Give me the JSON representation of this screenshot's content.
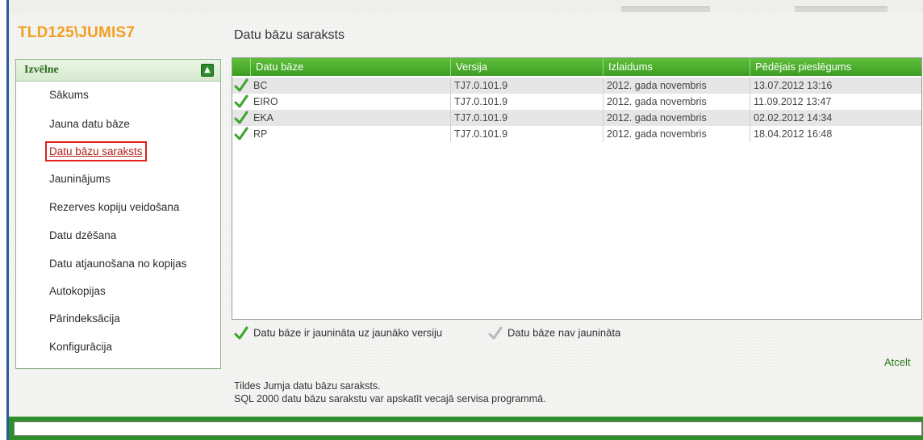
{
  "server_title": "TLD125\\JUMIS7",
  "page_title": "Datu bāzu saraksts",
  "menu": {
    "header": "Izvēlne",
    "items": [
      {
        "label": "Sākums"
      },
      {
        "label": "Jauna datu bāze"
      },
      {
        "label": "Datu bāzu saraksts",
        "active": true
      },
      {
        "label": "Jauninājums"
      },
      {
        "label": "Rezerves kopiju veidošana"
      },
      {
        "label": "Datu dzēšana"
      },
      {
        "label": "Datu atjaunošana no kopijas"
      },
      {
        "label": "Autokopijas"
      },
      {
        "label": "Pārindeksācija"
      },
      {
        "label": "Konfigurācija"
      }
    ]
  },
  "table": {
    "columns": [
      "Datu bāze",
      "Versija",
      "Izlaidums",
      "Pēdējais pieslēgums"
    ],
    "rows": [
      {
        "name": "BC",
        "version": "TJ7.0.101.9",
        "release": "2012. gada novembris",
        "last_login": "13.07.2012 13:16",
        "updated": true
      },
      {
        "name": "EIRO",
        "version": "TJ7.0.101.9",
        "release": "2012. gada novembris",
        "last_login": "11.09.2012 13:47",
        "updated": true
      },
      {
        "name": "EKA",
        "version": "TJ7.0.101.9",
        "release": "2012. gada novembris",
        "last_login": "02.02.2012 14:34",
        "updated": true
      },
      {
        "name": "RP",
        "version": "TJ7.0.101.9",
        "release": "2012. gada novembris",
        "last_login": "18.04.2012 16:48",
        "updated": true
      }
    ]
  },
  "legend": {
    "updated": "Datu bāze ir jaunināta uz jaunāko versiju",
    "not_updated": "Datu bāze nav jaunināta"
  },
  "cancel_label": "Atcelt",
  "notes": [
    "Tildes Jumja datu bāzu saraksts.",
    "SQL 2000 datu bāzu sarakstu var apskatīt vecajā servisa programmā."
  ],
  "colors": {
    "accent_green": "#3d9d24",
    "title_orange": "#f0a020",
    "active_red": "#e0201a"
  },
  "icons": {
    "check_green": "check-green-icon",
    "check_gray": "check-gray-icon",
    "collapse": "collapse-up-icon"
  }
}
